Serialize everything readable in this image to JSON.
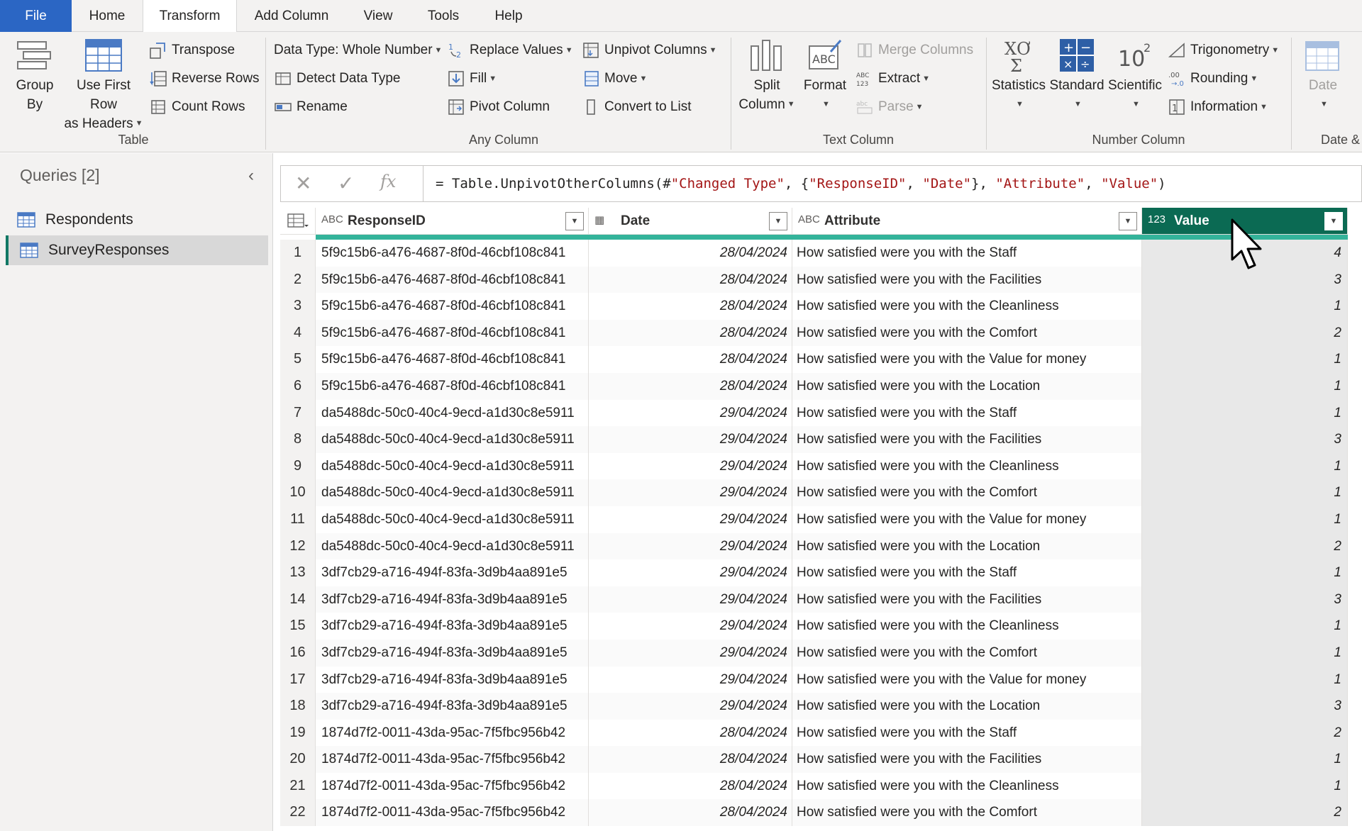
{
  "tabs": [
    {
      "label": "File"
    },
    {
      "label": "Home"
    },
    {
      "label": "Transform"
    },
    {
      "label": "Add Column"
    },
    {
      "label": "View"
    },
    {
      "label": "Tools"
    },
    {
      "label": "Help"
    }
  ],
  "ribbon": {
    "table": {
      "group_label": "Table",
      "group_by": {
        "line1": "Group",
        "line2": "By"
      },
      "use_first_row": {
        "line1": "Use First Row",
        "line2": "as Headers"
      },
      "transpose": "Transpose",
      "reverse_rows": "Reverse Rows",
      "count_rows": "Count Rows"
    },
    "any_column": {
      "group_label": "Any Column",
      "data_type": "Data Type: Whole Number",
      "detect_data_type": "Detect Data Type",
      "rename": "Rename",
      "replace_values": "Replace Values",
      "fill": "Fill",
      "pivot_column": "Pivot Column",
      "unpivot_columns": "Unpivot Columns",
      "move": "Move",
      "convert_to_list": "Convert to List"
    },
    "text_column": {
      "group_label": "Text Column",
      "split_column": {
        "line1": "Split",
        "line2": "Column"
      },
      "format": "Format",
      "merge_columns": "Merge Columns",
      "extract": "Extract",
      "parse": "Parse"
    },
    "number_column": {
      "group_label": "Number Column",
      "statistics": "Statistics",
      "standard": "Standard",
      "scientific": "Scientific",
      "trigonometry": "Trigonometry",
      "rounding": "Rounding",
      "information": "Information"
    },
    "date_column": {
      "group_label": "Date &",
      "date": "Date"
    }
  },
  "queries": {
    "title": "Queries [2]",
    "items": [
      {
        "label": "Respondents"
      },
      {
        "label": "SurveyResponses"
      }
    ]
  },
  "formula": {
    "prefix": "= Table.UnpivotOtherColumns(#",
    "s1": "\"Changed Type\"",
    "mid1": ", {",
    "s2": "\"ResponseID\"",
    "mid2": ", ",
    "s3": "\"Date\"",
    "mid3": "}, ",
    "s4": "\"Attribute\"",
    "mid4": ", ",
    "s5": "\"Value\"",
    "suffix": ")",
    "fx": "fx"
  },
  "columns": [
    {
      "type_label": "ABC",
      "name": "ResponseID"
    },
    {
      "type_label": "▦",
      "name": "Date"
    },
    {
      "type_label": "ABC",
      "name": "Attribute"
    },
    {
      "type_label": "123",
      "name": "Value"
    }
  ],
  "rows": [
    {
      "n": "1",
      "id": "5f9c15b6-a476-4687-8f0d-46cbf108c841",
      "date": "28/04/2024",
      "attr": "How satisfied were you with the Staff",
      "val": "4"
    },
    {
      "n": "2",
      "id": "5f9c15b6-a476-4687-8f0d-46cbf108c841",
      "date": "28/04/2024",
      "attr": "How satisfied were you with the Facilities",
      "val": "3"
    },
    {
      "n": "3",
      "id": "5f9c15b6-a476-4687-8f0d-46cbf108c841",
      "date": "28/04/2024",
      "attr": "How satisfied were you with the Cleanliness",
      "val": "1"
    },
    {
      "n": "4",
      "id": "5f9c15b6-a476-4687-8f0d-46cbf108c841",
      "date": "28/04/2024",
      "attr": "How satisfied were you with the Comfort",
      "val": "2"
    },
    {
      "n": "5",
      "id": "5f9c15b6-a476-4687-8f0d-46cbf108c841",
      "date": "28/04/2024",
      "attr": "How satisfied were you with  the Value for money",
      "val": "1"
    },
    {
      "n": "6",
      "id": "5f9c15b6-a476-4687-8f0d-46cbf108c841",
      "date": "28/04/2024",
      "attr": "How satisfied were you with the Location",
      "val": "1"
    },
    {
      "n": "7",
      "id": "da5488dc-50c0-40c4-9ecd-a1d30c8e5911",
      "date": "29/04/2024",
      "attr": "How satisfied were you with the Staff",
      "val": "1"
    },
    {
      "n": "8",
      "id": "da5488dc-50c0-40c4-9ecd-a1d30c8e5911",
      "date": "29/04/2024",
      "attr": "How satisfied were you with the Facilities",
      "val": "3"
    },
    {
      "n": "9",
      "id": "da5488dc-50c0-40c4-9ecd-a1d30c8e5911",
      "date": "29/04/2024",
      "attr": "How satisfied were you with the Cleanliness",
      "val": "1"
    },
    {
      "n": "10",
      "id": "da5488dc-50c0-40c4-9ecd-a1d30c8e5911",
      "date": "29/04/2024",
      "attr": "How satisfied were you with the Comfort",
      "val": "1"
    },
    {
      "n": "11",
      "id": "da5488dc-50c0-40c4-9ecd-a1d30c8e5911",
      "date": "29/04/2024",
      "attr": "How satisfied were you with  the Value for money",
      "val": "1"
    },
    {
      "n": "12",
      "id": "da5488dc-50c0-40c4-9ecd-a1d30c8e5911",
      "date": "29/04/2024",
      "attr": "How satisfied were you with the Location",
      "val": "2"
    },
    {
      "n": "13",
      "id": "3df7cb29-a716-494f-83fa-3d9b4aa891e5",
      "date": "29/04/2024",
      "attr": "How satisfied were you with the Staff",
      "val": "1"
    },
    {
      "n": "14",
      "id": "3df7cb29-a716-494f-83fa-3d9b4aa891e5",
      "date": "29/04/2024",
      "attr": "How satisfied were you with the Facilities",
      "val": "3"
    },
    {
      "n": "15",
      "id": "3df7cb29-a716-494f-83fa-3d9b4aa891e5",
      "date": "29/04/2024",
      "attr": "How satisfied were you with the Cleanliness",
      "val": "1"
    },
    {
      "n": "16",
      "id": "3df7cb29-a716-494f-83fa-3d9b4aa891e5",
      "date": "29/04/2024",
      "attr": "How satisfied were you with the Comfort",
      "val": "1"
    },
    {
      "n": "17",
      "id": "3df7cb29-a716-494f-83fa-3d9b4aa891e5",
      "date": "29/04/2024",
      "attr": "How satisfied were you with  the Value for money",
      "val": "1"
    },
    {
      "n": "18",
      "id": "3df7cb29-a716-494f-83fa-3d9b4aa891e5",
      "date": "29/04/2024",
      "attr": "How satisfied were you with the Location",
      "val": "3"
    },
    {
      "n": "19",
      "id": "1874d7f2-0011-43da-95ac-7f5fbc956b42",
      "date": "28/04/2024",
      "attr": "How satisfied were you with the Staff",
      "val": "2"
    },
    {
      "n": "20",
      "id": "1874d7f2-0011-43da-95ac-7f5fbc956b42",
      "date": "28/04/2024",
      "attr": "How satisfied were you with the Facilities",
      "val": "1"
    },
    {
      "n": "21",
      "id": "1874d7f2-0011-43da-95ac-7f5fbc956b42",
      "date": "28/04/2024",
      "attr": "How satisfied were you with the Cleanliness",
      "val": "1"
    },
    {
      "n": "22",
      "id": "1874d7f2-0011-43da-95ac-7f5fbc956b42",
      "date": "28/04/2024",
      "attr": "How satisfied were you with the Comfort",
      "val": "2"
    }
  ],
  "colors": {
    "file_tab": "#2b66c4",
    "selected_column_header": "#0b6a53",
    "quality_bar": "#33b39a",
    "selected_query_accent": "#117865"
  }
}
